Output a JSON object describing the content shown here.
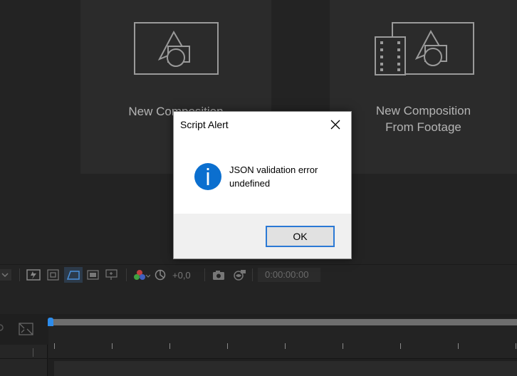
{
  "home": {
    "cards": [
      {
        "label": "New Composition"
      },
      {
        "label_line1": "New Composition",
        "label_line2": "From Footage"
      }
    ]
  },
  "toolbar": {
    "exposure_value": "+0,0",
    "timecode": "0:00:00:00"
  },
  "dialog": {
    "title": "Script Alert",
    "message_line1": "JSON validation error",
    "message_line2": "undefined",
    "icon": "info-icon",
    "ok_label": "OK"
  },
  "colors": {
    "accent": "#2b79d5",
    "info_icon": "#0b6fcf",
    "work_area_start": "#2d8ceb"
  }
}
